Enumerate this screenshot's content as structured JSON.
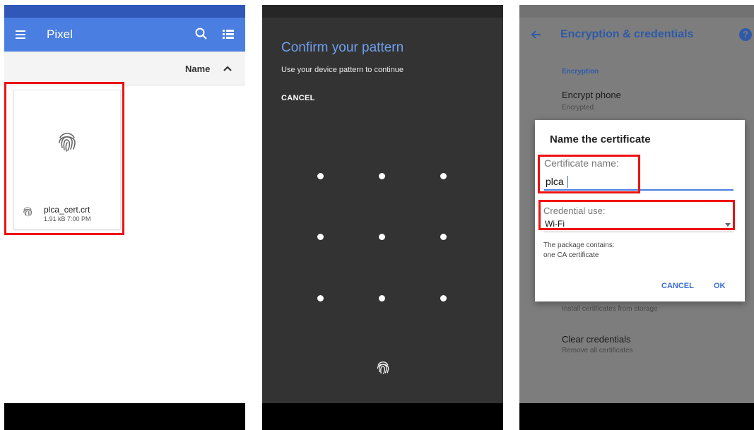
{
  "panel1": {
    "toolbar_title": "Pixel",
    "sort_label": "Name",
    "file": {
      "name": "plca_cert.crt",
      "meta": "1.91 kB 7:00 PM"
    },
    "icons": [
      "menu-icon",
      "search-icon",
      "list-view-icon",
      "sort-ascending-icon",
      "fingerprint-icon"
    ]
  },
  "panel2": {
    "title": "Confirm your pattern",
    "subtitle": "Use your device pattern to continue",
    "cancel_label": "CANCEL",
    "pattern_dots": 9
  },
  "panel3": {
    "title": "Encryption & credentials",
    "section_label": "Encryption",
    "encrypt_title": "Encrypt phone",
    "encrypt_status": "Encrypted",
    "install_subtitle": "Install certificates from storage",
    "clear_title": "Clear credentials",
    "clear_subtitle": "Remove all certificates",
    "dialog": {
      "title": "Name the certificate",
      "name_label": "Certificate name:",
      "name_value": "plca",
      "use_label": "Credential use:",
      "use_value": "Wi-Fi",
      "info_line1": "The package contains:",
      "info_line2": "one CA certificate",
      "cancel_label": "CANCEL",
      "ok_label": "OK"
    }
  },
  "colors": {
    "accent_blue": "#4a7ee0",
    "status_blue": "#3058b8",
    "highlight_red": "#ee1111",
    "pattern_title": "#6ea0ee"
  }
}
